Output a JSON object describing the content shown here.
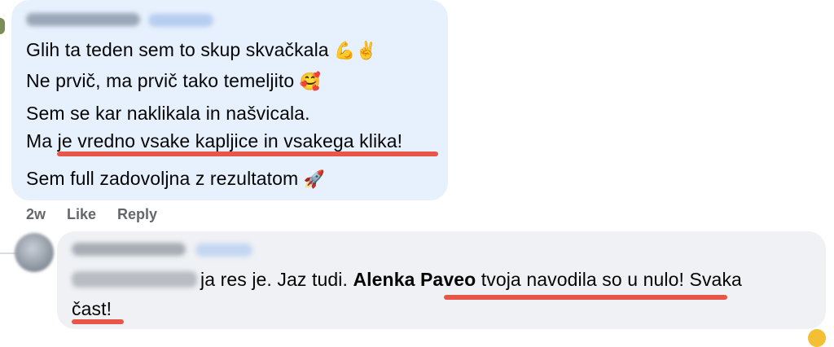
{
  "comment_1": {
    "lines": [
      "Glih ta teden sem to skup skvačkala",
      "Ne prvič, ma prvič tako temeljito",
      "Sem se kar naklikala in našvicala.",
      "Ma je vredno vsake kapljice in vsakega klika!",
      "Sem full zadovoljna z rezultatom"
    ],
    "emojis": [
      "💪",
      "✌️",
      "🥰",
      "🚀"
    ]
  },
  "actions": {
    "time": "2w",
    "like": "Like",
    "reply": "Reply"
  },
  "comment_2": {
    "text_a": "ja res je. Jaz tudi. ",
    "mention": "Alenka Paveo",
    "text_b": " tvoja navodila so u nulo! Svaka",
    "text_c": "čast!"
  },
  "colors": {
    "bubble_highlight": "#e7f1fd",
    "bubble_default": "#eff1f4",
    "underline": "#e8564a",
    "meta_text": "#65676b"
  }
}
